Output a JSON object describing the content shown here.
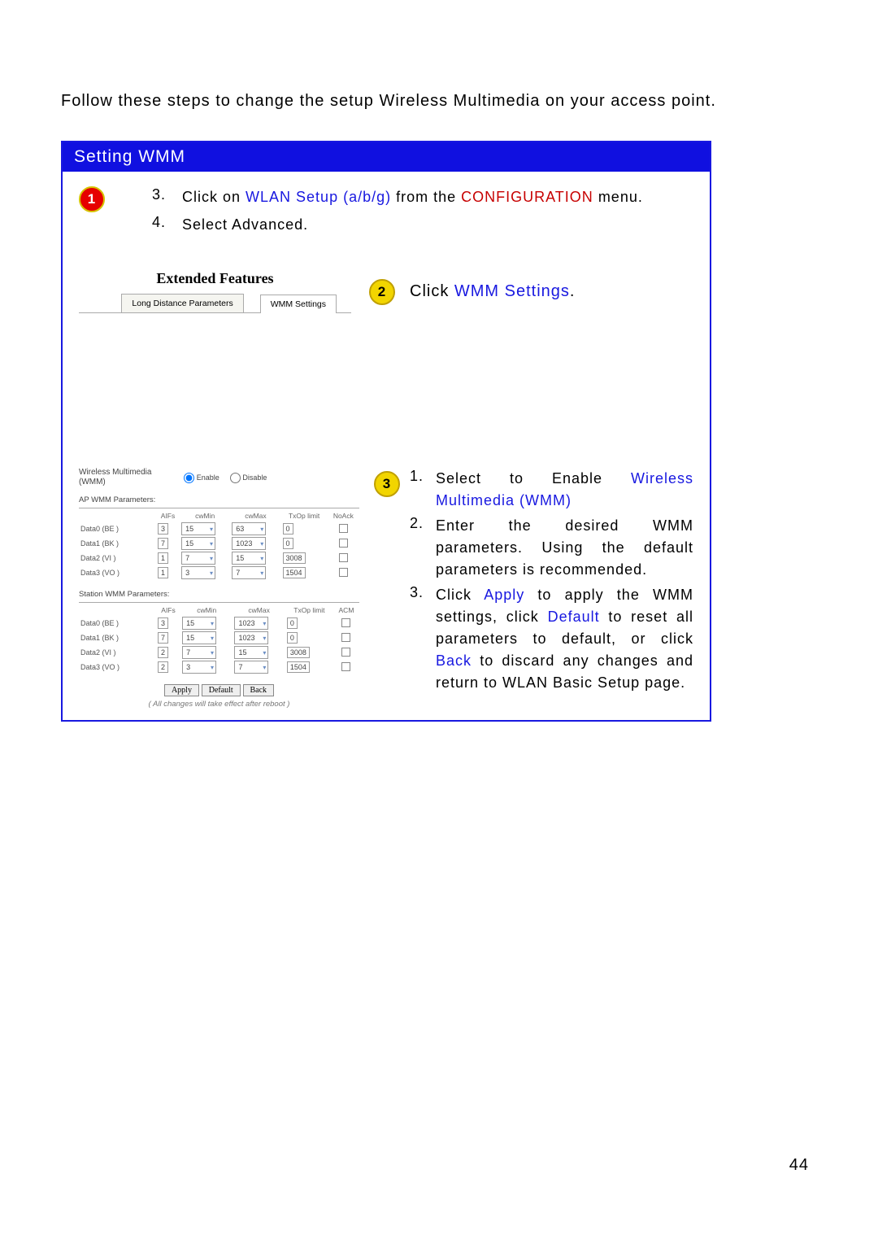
{
  "intro": "Follow these steps to change the setup Wireless Multimedia on your access point.",
  "bar_title": "Setting WMM",
  "badge_1": "1",
  "badge_2": "2",
  "badge_3": "3",
  "step1": {
    "items": [
      {
        "n": "3.",
        "pre": "Click on ",
        "link": "WLAN Setup (a/b/g)",
        "mid": " from the ",
        "red": "CONFIGURATION",
        "post": " menu."
      },
      {
        "n": "4.",
        "text": "Select Advanced."
      }
    ]
  },
  "tabs": {
    "title": "Extended Features",
    "left": "Long Distance Parameters",
    "right": "WMM Settings"
  },
  "step2": {
    "pre": "Click ",
    "link": "WMM Settings",
    "post": "."
  },
  "panel": {
    "group_label": "Wireless Multimedia (WMM)",
    "enable": "Enable",
    "disable": "Disable",
    "ap_section": "AP WMM Parameters:",
    "sta_section": "Station WMM Parameters:",
    "headers": [
      "AIFs",
      "cwMin",
      "cwMax",
      "TxOp limit",
      "NoAck"
    ],
    "headers2": [
      "AIFs",
      "cwMin",
      "cwMax",
      "TxOp limit",
      "ACM"
    ],
    "ap_rows": [
      {
        "name": "Data0 (BE )",
        "aifs": "3",
        "cwmin": "15",
        "cwmax": "63",
        "txop": "0",
        "chk": false
      },
      {
        "name": "Data1 (BK )",
        "aifs": "7",
        "cwmin": "15",
        "cwmax": "1023",
        "txop": "0",
        "chk": false
      },
      {
        "name": "Data2 (VI )",
        "aifs": "1",
        "cwmin": "7",
        "cwmax": "15",
        "txop": "3008",
        "chk": false
      },
      {
        "name": "Data3 (VO )",
        "aifs": "1",
        "cwmin": "3",
        "cwmax": "7",
        "txop": "1504",
        "chk": false
      }
    ],
    "sta_rows": [
      {
        "name": "Data0 (BE )",
        "aifs": "3",
        "cwmin": "15",
        "cwmax": "1023",
        "txop": "0",
        "chk": false
      },
      {
        "name": "Data1 (BK )",
        "aifs": "7",
        "cwmin": "15",
        "cwmax": "1023",
        "txop": "0",
        "chk": false
      },
      {
        "name": "Data2 (VI )",
        "aifs": "2",
        "cwmin": "7",
        "cwmax": "15",
        "txop": "3008",
        "chk": false
      },
      {
        "name": "Data3 (VO )",
        "aifs": "2",
        "cwmin": "3",
        "cwmax": "7",
        "txop": "1504",
        "chk": false
      }
    ],
    "buttons": {
      "apply": "Apply",
      "default": "Default",
      "back": "Back"
    },
    "note": "( All changes will take effect after reboot )"
  },
  "step3": [
    {
      "n": "1.",
      "parts": [
        {
          "text": "Select to Enable "
        },
        {
          "text": "Wireless Multimedia (WMM)",
          "cls": "link-blue"
        }
      ]
    },
    {
      "n": "2.",
      "parts": [
        {
          "text": "Enter the desired WMM parameters. Using the default parameters is recommended."
        }
      ]
    },
    {
      "n": "3.",
      "parts": [
        {
          "text": "Click "
        },
        {
          "text": "Apply",
          "cls": "link-blue"
        },
        {
          "text": " to apply the WMM settings, click "
        },
        {
          "text": "Default",
          "cls": "link-blue"
        },
        {
          "text": " to reset all parameters to default, or click "
        },
        {
          "text": "Back",
          "cls": "link-blue"
        },
        {
          "text": " to discard any changes and return to WLAN Basic Setup page."
        }
      ]
    }
  ],
  "page_number": "44"
}
